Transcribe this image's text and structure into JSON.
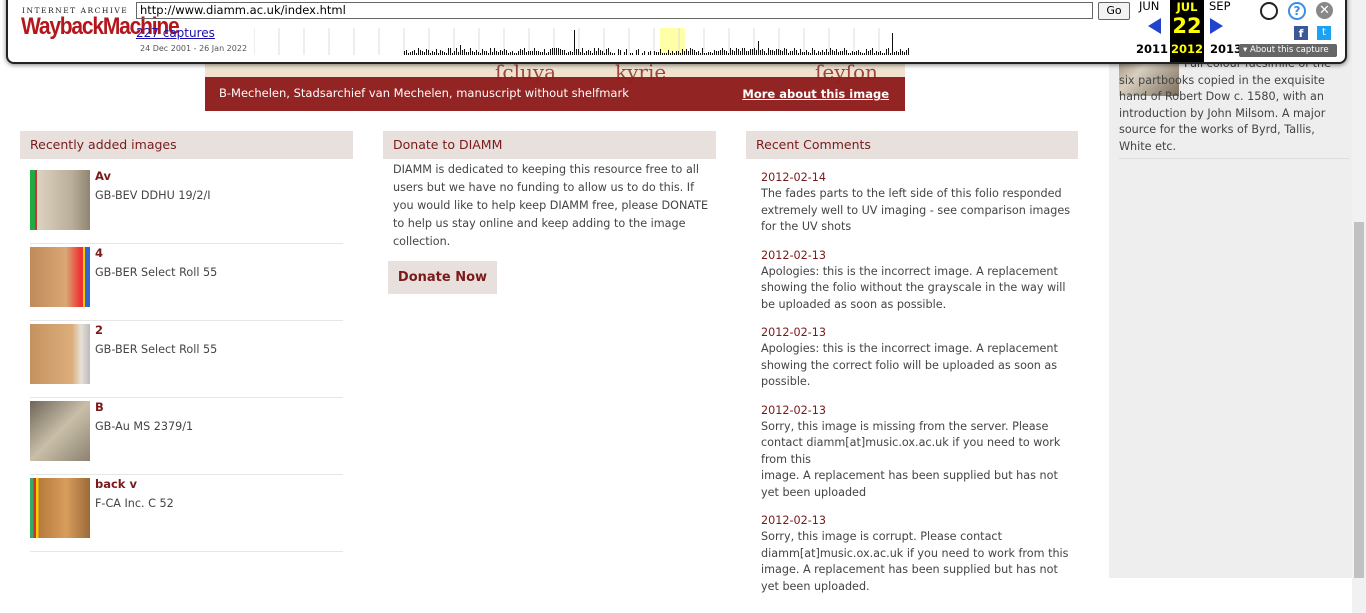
{
  "banner": {
    "caption": "B-Mechelen, Stadsarchief van Mechelen, manuscript without shelfmark",
    "more_link": "More about this image"
  },
  "sidebar": {
    "text": "Full colour facsimile of the six partbooks copied in the exquisite hand of Robert Dow c. 1580, with an introduction by John Milsom. A major source for the works of Byrd, Tallis, White etc."
  },
  "recent": {
    "heading": "Recently added images",
    "items": [
      {
        "title": "Av",
        "sub": "GB-BEV DDHU 19/2/I"
      },
      {
        "title": "4",
        "sub": "GB-BER Select Roll 55"
      },
      {
        "title": "2",
        "sub": "GB-BER Select Roll 55"
      },
      {
        "title": "B",
        "sub": "GB-Au MS 2379/1"
      },
      {
        "title": "back v",
        "sub": "F-CA Inc. C 52"
      }
    ]
  },
  "donate": {
    "heading": "Donate to DIAMM",
    "text": "DIAMM is dedicated to keeping this resource free to all users but we have no funding to allow us to do this. If you would like to help keep DIAMM free, please DONATE to help us stay online and keep adding to the image collection.",
    "button": "Donate Now"
  },
  "comments": {
    "heading": "Recent Comments",
    "items": [
      {
        "date": "2012-02-14",
        "body": "The fades parts to the left side of this folio responded extremely well to UV imaging - see comparison images for the UV shots"
      },
      {
        "date": "2012-02-13",
        "body": "Apologies: this is the incorrect image. A replacement showing the folio without the grayscale in the way will be uploaded as soon as possible."
      },
      {
        "date": "2012-02-13",
        "body": "Apologies: this is the incorrect image. A replacement showing the correct folio will be uploaded as soon as possible."
      },
      {
        "date": "2012-02-13",
        "body": "Sorry, this image is missing from the server. Please contact diamm[at]music.ox.ac.uk if you need to work from this",
        "body2": "image. A replacement has been supplied but has not yet been uploaded"
      },
      {
        "date": "2012-02-13",
        "body": "Sorry, this image is corrupt. Please contact diamm[at]music.ox.ac.uk if you need to work from this image. A replacement has been supplied but has not yet been uploaded."
      }
    ]
  },
  "wayback": {
    "brand_top": "INTERNET ARCHIVE",
    "brand": "WaybackMachine",
    "url": "http://www.diamm.ac.uk/index.html",
    "go": "Go",
    "captures": "227 captures",
    "range": "24 Dec 2001 - 26 Jan 2022",
    "prev_month": "JUN",
    "cur_month": "JUL",
    "next_month": "SEP",
    "cur_day": "22",
    "prev_year": "2011",
    "cur_year": "2012",
    "next_year": "2013",
    "about": "▾ About this capture",
    "help_glyph": "?",
    "close_glyph": "✕",
    "fb_glyph": "f",
    "tw_glyph": "t"
  }
}
